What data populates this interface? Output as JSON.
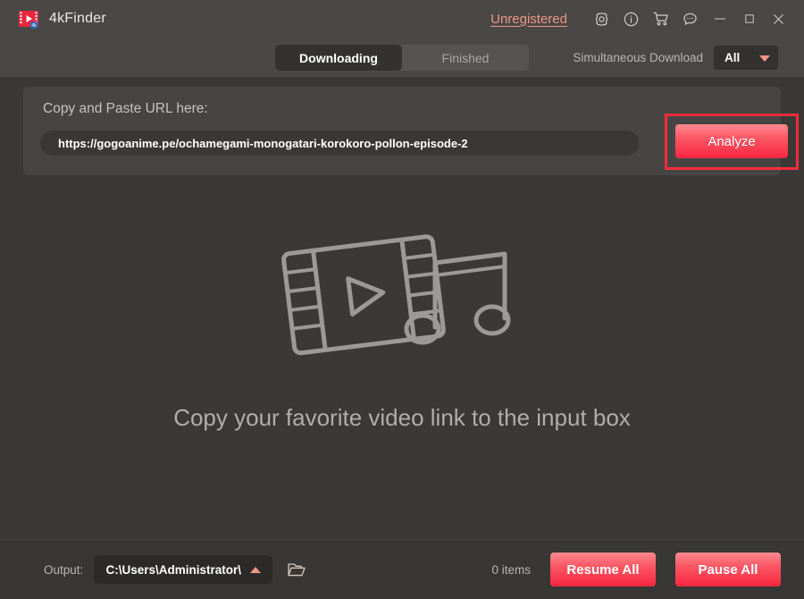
{
  "window": {
    "app_title": "4kFinder",
    "logo_icon": "film-play-logo-icon",
    "license_link": "Unregistered",
    "titlebar_icons": [
      {
        "name": "settings-gear-icon",
        "label": "Settings"
      },
      {
        "name": "info-icon",
        "label": "About"
      },
      {
        "name": "cart-icon",
        "label": "Buy"
      },
      {
        "name": "feedback-chat-icon",
        "label": "Feedback"
      },
      {
        "name": "minimize-icon",
        "label": "Minimize"
      },
      {
        "name": "maximize-icon",
        "label": "Maximize"
      },
      {
        "name": "close-icon",
        "label": "Close"
      }
    ]
  },
  "toolbar": {
    "tabs": [
      {
        "label": "Downloading",
        "active": true
      },
      {
        "label": "Finished",
        "active": false
      }
    ],
    "simultaneous_label": "Simultaneous Download",
    "simultaneous_value": "All",
    "dropdown_icon": "chevron-down-icon"
  },
  "url_panel": {
    "label": "Copy and Paste URL here:",
    "url_value": "https://gogoanime.pe/ochamegami-monogatari-korokoro-pollon-episode-2",
    "url_placeholder": "Copy and Paste URL here",
    "analyze_label": "Analyze",
    "highlight_color": "#f42c3c"
  },
  "empty_state": {
    "message": "Copy your favorite video link to the input box",
    "art_icons": [
      "film-strip-play-icon",
      "music-note-icon"
    ]
  },
  "footer": {
    "output_label": "Output:",
    "output_path": "C:\\Users\\Administrator\\",
    "output_caret_icon": "chevron-up-icon",
    "folder_icon": "open-folder-icon",
    "item_count": "0 items",
    "resume_all_label": "Resume All",
    "pause_all_label": "Pause All"
  },
  "colors": {
    "window_bg": "#3b3937",
    "titlebar_bg": "#4a4846",
    "card_bg": "#474543",
    "accent_pink": "#ef9587",
    "accent_red": "#f92640",
    "highlight_red": "#f42c3c"
  }
}
